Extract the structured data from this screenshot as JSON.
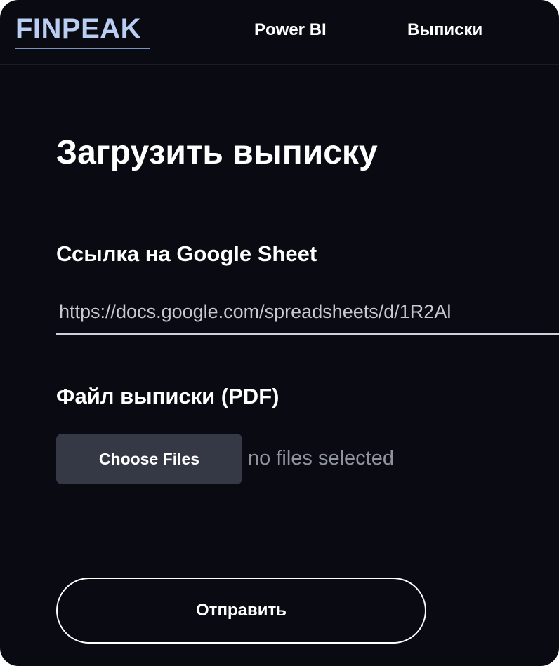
{
  "header": {
    "logo": "FINPEAK",
    "nav": [
      {
        "label": "Power BI"
      },
      {
        "label": "Выписки"
      }
    ]
  },
  "main": {
    "title": "Загрузить выписку",
    "sheet_field": {
      "label": "Ссылка на Google Sheet",
      "value": "https://docs.google.com/spreadsheets/d/1R2Al"
    },
    "pdf_field": {
      "label": "Файл выписки (PDF)",
      "button_label": "Choose Files",
      "status": "no files selected"
    },
    "submit_label": "Отправить"
  },
  "colors": {
    "background": "#0a0b12",
    "logo": "#b9cef2",
    "file_button": "#353945"
  }
}
